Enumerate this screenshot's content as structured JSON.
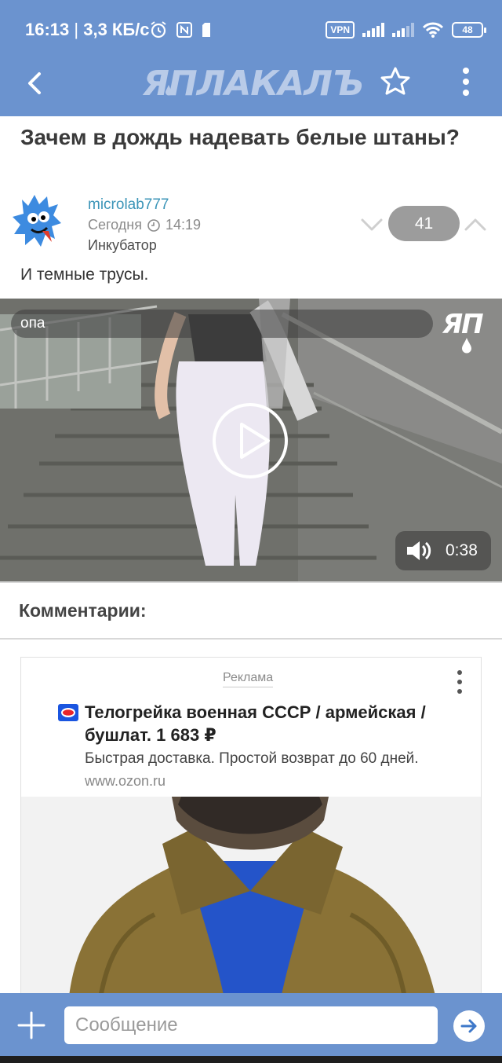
{
  "status_bar": {
    "time": "16:13",
    "network_speed": "3,3 КБ/с",
    "vpn": "VPN",
    "battery": "48"
  },
  "app_bar": {
    "logo": "ЯПЛАКАЛЪ",
    "icons": [
      "back-arrow-icon",
      "star-icon",
      "more-vert-icon"
    ]
  },
  "post": {
    "title": "Зачем в дождь надевать белые штаны?",
    "author": "microlab777",
    "time": "Сегодня",
    "time_value": "14:19",
    "category": "Инкубатор",
    "rating": "41",
    "text": "И темные трусы."
  },
  "video": {
    "caption": "опа",
    "watermark": "ЯП",
    "duration": "0:38"
  },
  "comments": {
    "heading": "Комментарии:"
  },
  "ad": {
    "label": "Реклама",
    "title": "Телогрейка военная СССР / армейская / бушлат. 1 683 ₽",
    "description": "Быстрая доставка. Простой возврат до 60 дней.",
    "url": "www.ozon.ru"
  },
  "composer": {
    "placeholder": "Сообщение"
  },
  "colors": {
    "app_bar": "#6b93cf",
    "link": "#3c95b8",
    "rating_pill": "#9c9c9c"
  }
}
